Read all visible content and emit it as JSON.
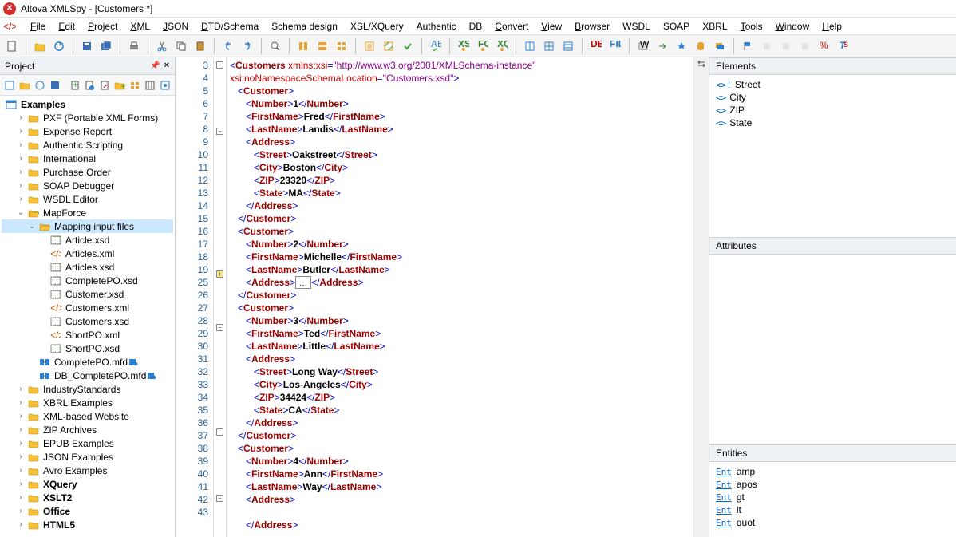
{
  "title": "Altova XMLSpy - [Customers *]",
  "menubar": [
    "File",
    "Edit",
    "Project",
    "XML",
    "JSON",
    "DTD/Schema",
    "Schema design",
    "XSL/XQuery",
    "Authentic",
    "DB",
    "Convert",
    "View",
    "Browser",
    "WSDL",
    "SOAP",
    "XBRL",
    "Tools",
    "Window",
    "Help"
  ],
  "menubar_underlined": [
    "F",
    "E",
    "P",
    "X",
    "J",
    "D",
    "",
    "",
    "",
    "",
    "C",
    "V",
    "B",
    "",
    "",
    "",
    "T",
    "W",
    "H"
  ],
  "project_panel": {
    "title": "Project",
    "root": "Examples",
    "items": [
      {
        "indent": 1,
        "toggle": ">",
        "icon": "folder",
        "label": "PXF (Portable XML Forms)"
      },
      {
        "indent": 1,
        "toggle": ">",
        "icon": "folder",
        "label": "Expense Report"
      },
      {
        "indent": 1,
        "toggle": ">",
        "icon": "folder",
        "label": "Authentic Scripting"
      },
      {
        "indent": 1,
        "toggle": ">",
        "icon": "folder",
        "label": "International"
      },
      {
        "indent": 1,
        "toggle": ">",
        "icon": "folder",
        "label": "Purchase Order"
      },
      {
        "indent": 1,
        "toggle": ">",
        "icon": "folder",
        "label": "SOAP Debugger"
      },
      {
        "indent": 1,
        "toggle": ">",
        "icon": "folder",
        "label": "WSDL Editor"
      },
      {
        "indent": 1,
        "toggle": "v",
        "icon": "folder-open",
        "label": "MapForce"
      },
      {
        "indent": 2,
        "toggle": "v",
        "icon": "folder-open",
        "label": "Mapping input files",
        "selected": true
      },
      {
        "indent": 3,
        "toggle": "",
        "icon": "xsd",
        "label": "Article.xsd"
      },
      {
        "indent": 3,
        "toggle": "",
        "icon": "xml",
        "label": "Articles.xml"
      },
      {
        "indent": 3,
        "toggle": "",
        "icon": "xsd",
        "label": "Articles.xsd"
      },
      {
        "indent": 3,
        "toggle": "",
        "icon": "xsd",
        "label": "CompletePO.xsd"
      },
      {
        "indent": 3,
        "toggle": "",
        "icon": "xsd",
        "label": "Customer.xsd"
      },
      {
        "indent": 3,
        "toggle": "",
        "icon": "xml",
        "label": "Customers.xml"
      },
      {
        "indent": 3,
        "toggle": "",
        "icon": "xsd",
        "label": "Customers.xsd"
      },
      {
        "indent": 3,
        "toggle": "",
        "icon": "xml",
        "label": "ShortPO.xml"
      },
      {
        "indent": 3,
        "toggle": "",
        "icon": "xsd",
        "label": "ShortPO.xsd"
      },
      {
        "indent": 2,
        "toggle": "",
        "icon": "mfd",
        "label": "CompletePO.mfd"
      },
      {
        "indent": 2,
        "toggle": "",
        "icon": "mfd",
        "label": "DB_CompletePO.mfd"
      },
      {
        "indent": 1,
        "toggle": ">",
        "icon": "folder",
        "label": "IndustryStandards"
      },
      {
        "indent": 1,
        "toggle": ">",
        "icon": "folder",
        "label": "XBRL Examples"
      },
      {
        "indent": 1,
        "toggle": ">",
        "icon": "folder",
        "label": "XML-based Website"
      },
      {
        "indent": 1,
        "toggle": ">",
        "icon": "folder",
        "label": "ZIP Archives"
      },
      {
        "indent": 1,
        "toggle": ">",
        "icon": "folder",
        "label": "EPUB Examples"
      },
      {
        "indent": 1,
        "toggle": ">",
        "icon": "folder",
        "label": "JSON Examples"
      },
      {
        "indent": 1,
        "toggle": ">",
        "icon": "folder",
        "label": "Avro Examples"
      },
      {
        "indent": 1,
        "toggle": ">",
        "icon": "folder",
        "label": "XQuery",
        "bold": true
      },
      {
        "indent": 1,
        "toggle": ">",
        "icon": "folder",
        "label": "XSLT2",
        "bold": true
      },
      {
        "indent": 1,
        "toggle": ">",
        "icon": "folder",
        "label": "Office",
        "bold": true
      },
      {
        "indent": 1,
        "toggle": ">",
        "icon": "folder",
        "label": "HTML5",
        "bold": true
      }
    ]
  },
  "editor": {
    "line_numbers": [
      3,
      4,
      5,
      6,
      7,
      8,
      9,
      10,
      11,
      12,
      13,
      14,
      15,
      16,
      17,
      18,
      19,
      25,
      26,
      27,
      28,
      29,
      30,
      31,
      32,
      33,
      34,
      35,
      36,
      37,
      38,
      39,
      40,
      41,
      42,
      43
    ],
    "fold_marks": {
      "0": "minus",
      "5": "minus",
      "16": "special-plus",
      "20": "minus",
      "28": "minus",
      "33": "minus"
    },
    "lines": [
      [
        {
          "t": "tag",
          "v": "<"
        },
        {
          "t": "decl",
          "v": "Customers"
        },
        {
          "t": "tag",
          "v": " "
        },
        {
          "t": "attr",
          "v": "xmlns:xsi"
        },
        {
          "t": "tag",
          "v": "="
        },
        {
          "t": "val",
          "v": "\"http://www.w3.org/2001/XMLSchema-instance\""
        }
      ],
      [
        {
          "t": "attr",
          "v": "xsi:noNamespaceSchemaLocation"
        },
        {
          "t": "tag",
          "v": "="
        },
        {
          "t": "val",
          "v": "\"Customers.xsd\""
        },
        {
          "t": "tag",
          "v": ">"
        }
      ],
      [
        {
          "t": "tag",
          "v": "   <"
        },
        {
          "t": "decl",
          "v": "Customer"
        },
        {
          "t": "tag",
          "v": ">"
        }
      ],
      [
        {
          "t": "tag",
          "v": "      <"
        },
        {
          "t": "decl",
          "v": "Number"
        },
        {
          "t": "tag",
          "v": ">"
        },
        {
          "t": "text",
          "v": "1"
        },
        {
          "t": "tag",
          "v": "</"
        },
        {
          "t": "decl",
          "v": "Number"
        },
        {
          "t": "tag",
          "v": ">"
        }
      ],
      [
        {
          "t": "tag",
          "v": "      <"
        },
        {
          "t": "decl",
          "v": "FirstName"
        },
        {
          "t": "tag",
          "v": ">"
        },
        {
          "t": "text",
          "v": "Fred"
        },
        {
          "t": "tag",
          "v": "</"
        },
        {
          "t": "decl",
          "v": "FirstName"
        },
        {
          "t": "tag",
          "v": ">"
        }
      ],
      [
        {
          "t": "tag",
          "v": "      <"
        },
        {
          "t": "decl",
          "v": "LastName"
        },
        {
          "t": "tag",
          "v": ">"
        },
        {
          "t": "text",
          "v": "Landis"
        },
        {
          "t": "tag",
          "v": "</"
        },
        {
          "t": "decl",
          "v": "LastName"
        },
        {
          "t": "tag",
          "v": ">"
        }
      ],
      [
        {
          "t": "tag",
          "v": "      <"
        },
        {
          "t": "decl",
          "v": "Address"
        },
        {
          "t": "tag",
          "v": ">"
        }
      ],
      [
        {
          "t": "tag",
          "v": "         <"
        },
        {
          "t": "decl",
          "v": "Street"
        },
        {
          "t": "tag",
          "v": ">"
        },
        {
          "t": "text",
          "v": "Oakstreet"
        },
        {
          "t": "tag",
          "v": "</"
        },
        {
          "t": "decl",
          "v": "Street"
        },
        {
          "t": "tag",
          "v": ">"
        }
      ],
      [
        {
          "t": "tag",
          "v": "         <"
        },
        {
          "t": "decl",
          "v": "City"
        },
        {
          "t": "tag",
          "v": ">"
        },
        {
          "t": "text",
          "v": "Boston"
        },
        {
          "t": "tag",
          "v": "</"
        },
        {
          "t": "decl",
          "v": "City"
        },
        {
          "t": "tag",
          "v": ">"
        }
      ],
      [
        {
          "t": "tag",
          "v": "         <"
        },
        {
          "t": "decl",
          "v": "ZIP"
        },
        {
          "t": "tag",
          "v": ">"
        },
        {
          "t": "text",
          "v": "23320"
        },
        {
          "t": "tag",
          "v": "</"
        },
        {
          "t": "decl",
          "v": "ZIP"
        },
        {
          "t": "tag",
          "v": ">"
        }
      ],
      [
        {
          "t": "tag",
          "v": "         <"
        },
        {
          "t": "decl",
          "v": "State"
        },
        {
          "t": "tag",
          "v": ">"
        },
        {
          "t": "text",
          "v": "MA"
        },
        {
          "t": "tag",
          "v": "</"
        },
        {
          "t": "decl",
          "v": "State"
        },
        {
          "t": "tag",
          "v": ">"
        }
      ],
      [
        {
          "t": "tag",
          "v": "      </"
        },
        {
          "t": "decl",
          "v": "Address"
        },
        {
          "t": "tag",
          "v": ">"
        }
      ],
      [
        {
          "t": "tag",
          "v": "   </"
        },
        {
          "t": "decl",
          "v": "Customer"
        },
        {
          "t": "tag",
          "v": ">"
        }
      ],
      [
        {
          "t": "tag",
          "v": "   <"
        },
        {
          "t": "decl",
          "v": "Customer"
        },
        {
          "t": "tag",
          "v": ">"
        }
      ],
      [
        {
          "t": "tag",
          "v": "      <"
        },
        {
          "t": "decl",
          "v": "Number"
        },
        {
          "t": "tag",
          "v": ">"
        },
        {
          "t": "text",
          "v": "2"
        },
        {
          "t": "tag",
          "v": "</"
        },
        {
          "t": "decl",
          "v": "Number"
        },
        {
          "t": "tag",
          "v": ">"
        }
      ],
      [
        {
          "t": "tag",
          "v": "      <"
        },
        {
          "t": "decl",
          "v": "FirstName"
        },
        {
          "t": "tag",
          "v": ">"
        },
        {
          "t": "text",
          "v": "Michelle"
        },
        {
          "t": "tag",
          "v": "</"
        },
        {
          "t": "decl",
          "v": "FirstName"
        },
        {
          "t": "tag",
          "v": ">"
        }
      ],
      [
        {
          "t": "tag",
          "v": "      <"
        },
        {
          "t": "decl",
          "v": "LastName"
        },
        {
          "t": "tag",
          "v": ">"
        },
        {
          "t": "text",
          "v": "Butler"
        },
        {
          "t": "tag",
          "v": "</"
        },
        {
          "t": "decl",
          "v": "LastName"
        },
        {
          "t": "tag",
          "v": ">"
        }
      ],
      [
        {
          "t": "tag",
          "v": "      <"
        },
        {
          "t": "decl",
          "v": "Address"
        },
        {
          "t": "tag",
          "v": ">"
        },
        {
          "t": "box",
          "v": "..."
        },
        {
          "t": "tag",
          "v": "</"
        },
        {
          "t": "decl",
          "v": "Address"
        },
        {
          "t": "tag",
          "v": ">"
        }
      ],
      [
        {
          "t": "tag",
          "v": "   </"
        },
        {
          "t": "decl",
          "v": "Customer"
        },
        {
          "t": "tag",
          "v": ">"
        }
      ],
      [
        {
          "t": "tag",
          "v": "   <"
        },
        {
          "t": "decl",
          "v": "Customer"
        },
        {
          "t": "tag",
          "v": ">"
        }
      ],
      [
        {
          "t": "tag",
          "v": "      <"
        },
        {
          "t": "decl",
          "v": "Number"
        },
        {
          "t": "tag",
          "v": ">"
        },
        {
          "t": "text",
          "v": "3"
        },
        {
          "t": "tag",
          "v": "</"
        },
        {
          "t": "decl",
          "v": "Number"
        },
        {
          "t": "tag",
          "v": ">"
        }
      ],
      [
        {
          "t": "tag",
          "v": "      <"
        },
        {
          "t": "decl",
          "v": "FirstName"
        },
        {
          "t": "tag",
          "v": ">"
        },
        {
          "t": "text",
          "v": "Ted"
        },
        {
          "t": "tag",
          "v": "</"
        },
        {
          "t": "decl",
          "v": "FirstName"
        },
        {
          "t": "tag",
          "v": ">"
        }
      ],
      [
        {
          "t": "tag",
          "v": "      <"
        },
        {
          "t": "decl",
          "v": "LastName"
        },
        {
          "t": "tag",
          "v": ">"
        },
        {
          "t": "text",
          "v": "Little"
        },
        {
          "t": "tag",
          "v": "</"
        },
        {
          "t": "decl",
          "v": "LastName"
        },
        {
          "t": "tag",
          "v": ">"
        }
      ],
      [
        {
          "t": "tag",
          "v": "      <"
        },
        {
          "t": "decl",
          "v": "Address"
        },
        {
          "t": "tag",
          "v": ">"
        }
      ],
      [
        {
          "t": "tag",
          "v": "         <"
        },
        {
          "t": "decl",
          "v": "Street"
        },
        {
          "t": "tag",
          "v": ">"
        },
        {
          "t": "text",
          "v": "Long Way"
        },
        {
          "t": "tag",
          "v": "</"
        },
        {
          "t": "decl",
          "v": "Street"
        },
        {
          "t": "tag",
          "v": ">"
        }
      ],
      [
        {
          "t": "tag",
          "v": "         <"
        },
        {
          "t": "decl",
          "v": "City"
        },
        {
          "t": "tag",
          "v": ">"
        },
        {
          "t": "text",
          "v": "Los-Angeles"
        },
        {
          "t": "tag",
          "v": "</"
        },
        {
          "t": "decl",
          "v": "City"
        },
        {
          "t": "tag",
          "v": ">"
        }
      ],
      [
        {
          "t": "tag",
          "v": "         <"
        },
        {
          "t": "decl",
          "v": "ZIP"
        },
        {
          "t": "tag",
          "v": ">"
        },
        {
          "t": "text",
          "v": "34424"
        },
        {
          "t": "tag",
          "v": "</"
        },
        {
          "t": "decl",
          "v": "ZIP"
        },
        {
          "t": "tag",
          "v": ">"
        }
      ],
      [
        {
          "t": "tag",
          "v": "         <"
        },
        {
          "t": "decl",
          "v": "State"
        },
        {
          "t": "tag",
          "v": ">"
        },
        {
          "t": "text",
          "v": "CA"
        },
        {
          "t": "tag",
          "v": "</"
        },
        {
          "t": "decl",
          "v": "State"
        },
        {
          "t": "tag",
          "v": ">"
        }
      ],
      [
        {
          "t": "tag",
          "v": "      </"
        },
        {
          "t": "decl",
          "v": "Address"
        },
        {
          "t": "tag",
          "v": ">"
        }
      ],
      [
        {
          "t": "tag",
          "v": "   </"
        },
        {
          "t": "decl",
          "v": "Customer"
        },
        {
          "t": "tag",
          "v": ">"
        }
      ],
      [
        {
          "t": "tag",
          "v": "   <"
        },
        {
          "t": "decl",
          "v": "Customer"
        },
        {
          "t": "tag",
          "v": ">"
        }
      ],
      [
        {
          "t": "tag",
          "v": "      <"
        },
        {
          "t": "decl",
          "v": "Number"
        },
        {
          "t": "tag",
          "v": ">"
        },
        {
          "t": "text",
          "v": "4"
        },
        {
          "t": "tag",
          "v": "</"
        },
        {
          "t": "decl",
          "v": "Number"
        },
        {
          "t": "tag",
          "v": ">"
        }
      ],
      [
        {
          "t": "tag",
          "v": "      <"
        },
        {
          "t": "decl",
          "v": "FirstName"
        },
        {
          "t": "tag",
          "v": ">"
        },
        {
          "t": "text",
          "v": "Ann"
        },
        {
          "t": "tag",
          "v": "</"
        },
        {
          "t": "decl",
          "v": "FirstName"
        },
        {
          "t": "tag",
          "v": ">"
        }
      ],
      [
        {
          "t": "tag",
          "v": "      <"
        },
        {
          "t": "decl",
          "v": "LastName"
        },
        {
          "t": "tag",
          "v": ">"
        },
        {
          "t": "text",
          "v": "Way"
        },
        {
          "t": "tag",
          "v": "</"
        },
        {
          "t": "decl",
          "v": "LastName"
        },
        {
          "t": "tag",
          "v": ">"
        }
      ],
      [
        {
          "t": "tag",
          "v": "      <"
        },
        {
          "t": "decl",
          "v": "Address"
        },
        {
          "t": "tag",
          "v": ">"
        }
      ],
      [
        {
          "t": "tag",
          "v": "         "
        }
      ],
      [
        {
          "t": "tag",
          "v": "      </"
        },
        {
          "t": "decl",
          "v": "Address"
        },
        {
          "t": "tag",
          "v": ">"
        }
      ]
    ]
  },
  "elements_panel": {
    "title": "Elements",
    "items": [
      {
        "prefix": "<>!",
        "label": "Street"
      },
      {
        "prefix": "<>",
        "label": "City"
      },
      {
        "prefix": "<>",
        "label": "ZIP"
      },
      {
        "prefix": "<>",
        "label": "State"
      }
    ]
  },
  "attributes_panel": {
    "title": "Attributes"
  },
  "entities_panel": {
    "title": "Entities",
    "items": [
      "amp",
      "apos",
      "gt",
      "lt",
      "quot"
    ]
  }
}
